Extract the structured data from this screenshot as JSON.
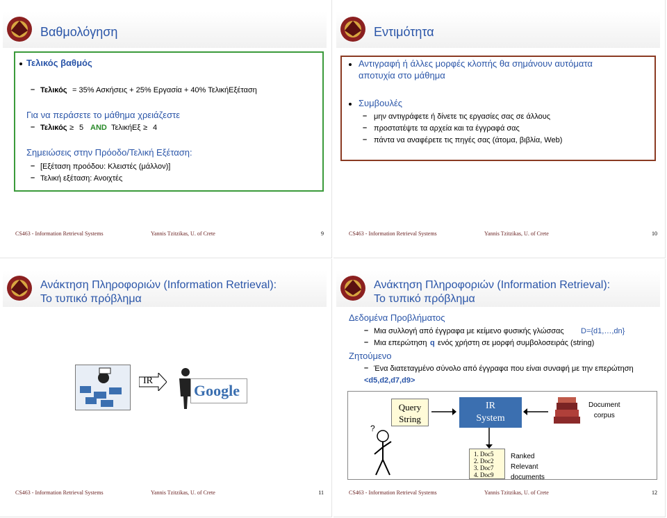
{
  "slides": {
    "s1": {
      "title": "Βαθμολόγηση",
      "heading": "Τελικός βαθμός",
      "formula_bold": "Τελικός",
      "formula_rest": "= 35% Ασκήσεις + 25% Εργασία + 40% ΤελικήΕξέταση",
      "pass_line": "Για να περάσετε το μάθημα χρειάζεστε",
      "pass_final": "Τελικός",
      "pass_geq1": "≥",
      "pass_val1": "5",
      "pass_and": "AND",
      "pass_exam": "ΤελικήΕξ",
      "pass_geq2": "≥",
      "pass_val2": "4",
      "notes_line": "Σημειώσεις στην Πρόοδο/Τελική Εξέταση:",
      "note1": "[Εξέταση προόδου: Κλειστές (μάλλον)]",
      "note2": "Τελική εξέταση: Ανοιχτές",
      "page": "9"
    },
    "s2": {
      "title": "Εντιμότητα",
      "line1a": "Αντιγραφή ή άλλες μορφές κλοπής θα σημάνουν αυτόματα",
      "line1b": "αποτυχία στο μάθημα",
      "advice": "Συμβουλές",
      "adv1": "μην αντιγράφετε ή δίνετε τις εργασίες σας σε άλλους",
      "adv2": "προστατέψτε τα αρχεία και τα έγγραφά σας",
      "adv3": "πάντα να αναφέρετε τις πηγές σας (άτομα, βιβλία, Web)",
      "page": "10"
    },
    "s3": {
      "title_line1": "Ανάκτηση Πληροφοριών (Information Retrieval):",
      "title_line2": "Το τυπικό πρόβλημα",
      "ir_label": "IR",
      "google_label": "Google",
      "page": "11"
    },
    "s4": {
      "title_line1": "Ανάκτηση Πληροφοριών (Information Retrieval):",
      "title_line2": "Το τυπικό πρόβλημα",
      "given": "Δεδομένα Προβλήματος",
      "given1a": "Μια συλλογή από έγγραφα με κείμενο φυσικής γλώσσας",
      "given1b": "D={d1,…,dn}",
      "given2a": "Μια επερώτηση",
      "given2b": "q",
      "given2c": "ενός χρήστη σε μορφή συμβολοσειράς (string)",
      "wanted": "Ζητούμενο",
      "wanted1": "Ένα διατεταγμένο σύνολο από έγγραφα που είναι συναφή με την επερώτηση",
      "wanted2": "<d5,d2,d7,d9>",
      "query_l1": "Query",
      "query_l2": "String",
      "ir_l1": "IR",
      "ir_l2": "System",
      "corpus_l1": "Document",
      "corpus_l2": "corpus",
      "docs": [
        "1. Doc5",
        "2. Doc2",
        "3. Doc7",
        "4. Doc9"
      ],
      "ranked_l1": "Ranked",
      "ranked_l2": "Relevant",
      "ranked_l3": "documents",
      "question_mark": "?",
      "page": "12"
    }
  },
  "footer": {
    "course": "CS463 - Information Retrieval Systems",
    "author": "Yannis Tzitzikas, U. of Crete"
  },
  "colors": {
    "title": "#2a55a8",
    "border": "#3a9a3a",
    "and": "#2a8a2a",
    "ir_box": "#3b6fb0"
  }
}
